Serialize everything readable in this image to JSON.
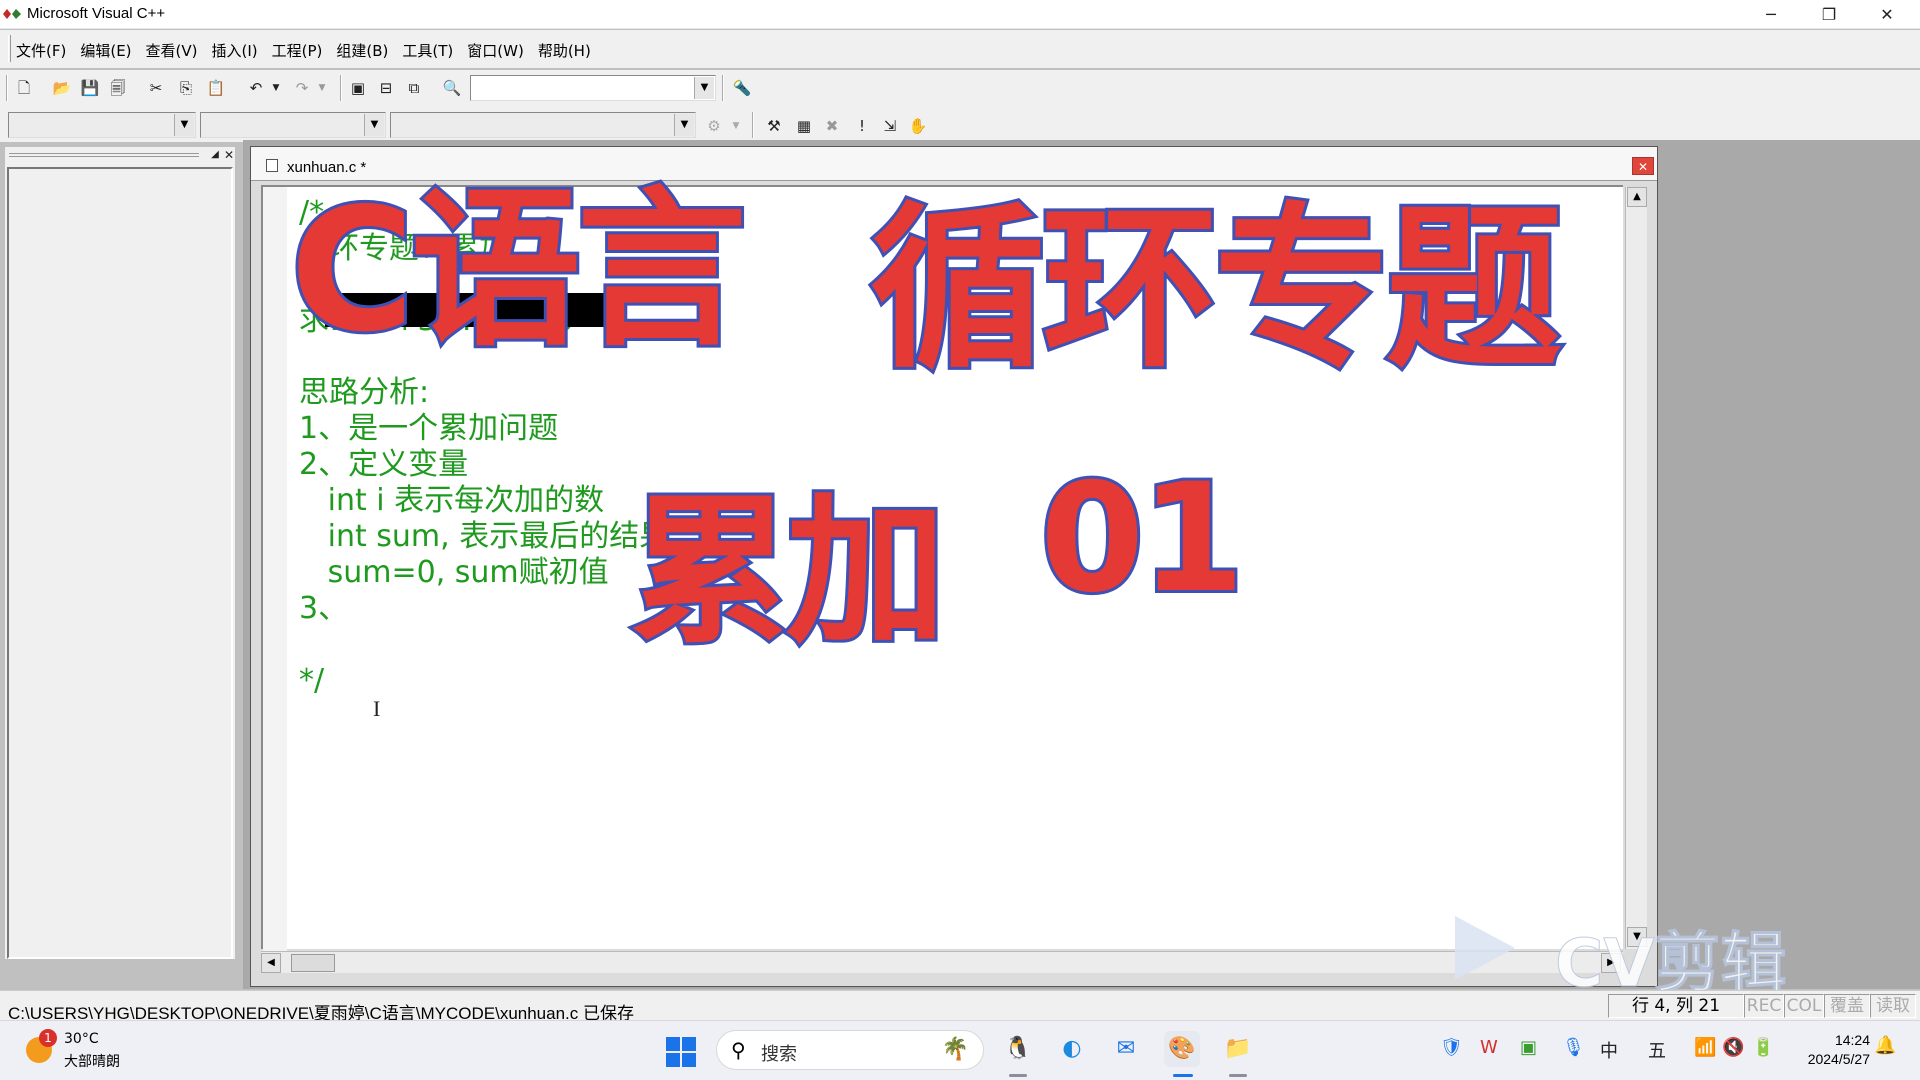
{
  "window": {
    "title": "Microsoft Visual C++",
    "minimize": "─",
    "restore": "❐",
    "close": "✕"
  },
  "menu": [
    "文件(F)",
    "编辑(E)",
    "查看(V)",
    "插入(I)",
    "工程(P)",
    "组建(B)",
    "工具(T)",
    "窗口(W)",
    "帮助(H)"
  ],
  "editor": {
    "tab_title": "xunhuan.c *",
    "lines": [
      {
        "text": "/*",
        "row": 0
      },
      {
        "text": "循环专题：累加",
        "row": 1
      },
      {
        "text": "求1+2+3+…+100",
        "row": 3
      },
      {
        "text": "思路分析:",
        "row": 5
      },
      {
        "text": "1、是一个累加问题",
        "row": 6
      },
      {
        "text": "2、定义变量",
        "row": 7
      },
      {
        "text": "   int i 表示每次加的数",
        "row": 8
      },
      {
        "text": "   int sum, 表示最后的结果",
        "row": 9
      },
      {
        "text": "   sum=0, sum赋初值",
        "row": 10
      },
      {
        "text": "3、",
        "row": 11
      },
      {
        "text": "*/",
        "row": 13
      }
    ]
  },
  "overlays": {
    "title_c": "C语言",
    "title_loop": "循环专题",
    "subtitle": "累加",
    "episode": "01"
  },
  "watermark": "CV剪辑",
  "status": {
    "message": "C:\\USERS\\YHG\\DESKTOP\\ONEDRIVE\\夏雨婷\\C语言\\MYCODE\\xunhuan.c 已保存",
    "position": "行 4, 列 21",
    "rec": "REC",
    "col": "COL",
    "ovr": "覆盖",
    "read": "读取"
  },
  "taskbar": {
    "weather_temp": "30°C",
    "weather_desc": "大部晴朗",
    "weather_badge": "1",
    "search_placeholder": "搜索",
    "ime_lang": "中",
    "ime_mode": "五",
    "time": "14:24",
    "date": "2024/5/27"
  },
  "colors": {
    "code_comment": "#1f9a1f",
    "overlay_fill": "#e53935",
    "overlay_stroke": "#3f51b5"
  }
}
